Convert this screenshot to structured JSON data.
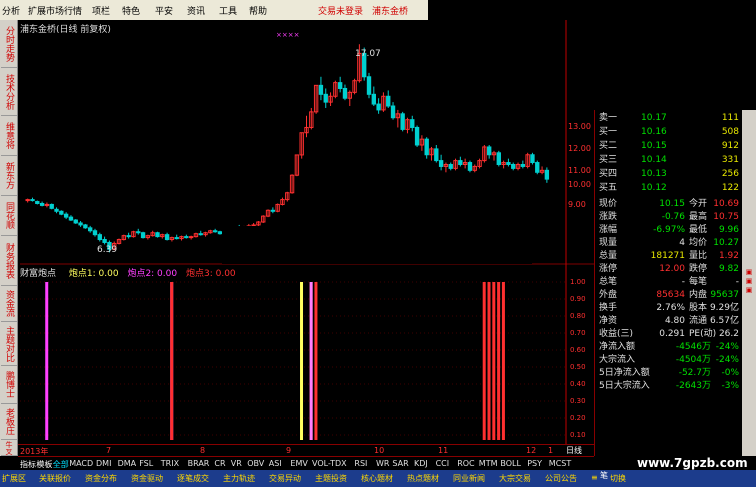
{
  "menu": {
    "items": [
      "分析",
      "扩展市场行情",
      "项栏",
      "特色",
      "平安",
      "资讯",
      "工具",
      "帮助"
    ],
    "login": "交易未登录",
    "stock": "浦东金桥"
  },
  "left_tabs": [
    "分时走势",
    "技术分析",
    "维意将",
    "新东方",
    "同花顺",
    "财务报表",
    "资金流",
    "主题对比",
    "鹏博士",
    "老板庄",
    "牛叉诊股"
  ],
  "main_chart": {
    "title": "浦东金桥(日线 前复权)",
    "high_label": "17.07",
    "low_label": "6.39",
    "y_ticks": [
      "13.00",
      "12.00",
      "11.00",
      "10.00",
      "9.00"
    ],
    "markers": "××××"
  },
  "indicator": {
    "name": "财富炮点",
    "p1_label": "炮点1: 0.00",
    "p2_label": "炮点2: 0.00",
    "p3_label": "炮点3: 0.00",
    "y_ticks": [
      "1.00",
      "0.90",
      "0.80",
      "0.70",
      "0.60",
      "0.50",
      "0.40",
      "0.30",
      "0.20",
      "0.10"
    ]
  },
  "x_axis": {
    "labels": [
      "2013年",
      "7",
      "8",
      "9",
      "10",
      "11",
      "12",
      "1"
    ]
  },
  "quote": {
    "rows": [
      {
        "l": "卖一",
        "v": "10.17",
        "r": "111"
      },
      {
        "l": "买一",
        "v": "10.16",
        "r": "508"
      },
      {
        "l": "买二",
        "v": "10.15",
        "r": "912"
      },
      {
        "l": "买三",
        "v": "10.14",
        "r": "331"
      },
      {
        "l": "买四",
        "v": "10.13",
        "r": "256"
      },
      {
        "l": "买五",
        "v": "10.12",
        "r": "122"
      }
    ],
    "stats": [
      {
        "a": "现价",
        "b": "10.15",
        "c": "今开",
        "d": "10.69"
      },
      {
        "a": "涨跌",
        "b": "-0.76",
        "c": "最高",
        "d": "10.75"
      },
      {
        "a": "涨幅",
        "b": "-6.97%",
        "c": "最低",
        "d": "9.96"
      },
      {
        "a": "现量",
        "b": "4",
        "c": "均价",
        "d": "10.27"
      },
      {
        "a": "总量",
        "b": "181271",
        "c": "量比",
        "d": "1.92"
      },
      {
        "a": "涨停",
        "b": "12.00",
        "c": "跌停",
        "d": "9.82"
      },
      {
        "a": "总笔",
        "b": "-",
        "c": "每笔",
        "d": "-"
      },
      {
        "a": "外盘",
        "b": "85634",
        "c": "内盘",
        "d": "95637"
      },
      {
        "a": "换手",
        "b": "2.76%",
        "c": "股本",
        "d": "9.29亿"
      },
      {
        "a": "净资",
        "b": "4.80",
        "c": "流通",
        "d": "6.57亿"
      },
      {
        "a": "收益(三)",
        "b": "0.291",
        "c": "PE(动)",
        "d": "26.2"
      }
    ],
    "flows": [
      {
        "a": "净流入额",
        "b": "-4546万",
        "c": "-24%"
      },
      {
        "a": "大宗流入",
        "b": "-4504万",
        "c": "-24%"
      },
      {
        "a": "5日净流入额",
        "b": "-52.7万",
        "c": "-0%"
      },
      {
        "a": "5日大宗流入",
        "b": "-2643万",
        "c": "-3%"
      }
    ]
  },
  "bottom_tabs": [
    "指标",
    "模板",
    "全部",
    "MACD",
    "DMI",
    "DMA",
    "FSL",
    "TRIX",
    "BRAR",
    "CR",
    "VR",
    "OBV",
    "ASI",
    "EMV",
    "VOL-TDX",
    "RSI",
    "WR",
    "SAR",
    "KDJ",
    "CCI",
    "ROC",
    "MTM",
    "BOLL",
    "PSY",
    "MCST"
  ],
  "status_tabs": [
    "扩展区",
    "关联报价",
    "资金分布",
    "资金驱动",
    "逐笔成交",
    "主力轨迹",
    "交易异动",
    "主题投资",
    "核心题材",
    "热点题材",
    "同业新闻",
    "大宗交易",
    "公司公告",
    "≡",
    "切换"
  ],
  "side_tabs": {
    "daily": "日线",
    "pen": "笔"
  },
  "watermark": "www.7gpzb.com",
  "chart_data": {
    "type": "candlestick",
    "ohlc": [
      [
        9.05,
        9.15,
        8.95,
        9.1
      ],
      [
        9.1,
        9.2,
        9.0,
        9.05
      ],
      [
        9.0,
        9.05,
        8.85,
        8.9
      ],
      [
        8.9,
        9.0,
        8.75,
        8.8
      ],
      [
        8.8,
        8.95,
        8.7,
        8.85
      ],
      [
        8.85,
        8.9,
        8.6,
        8.65
      ],
      [
        8.6,
        8.7,
        8.4,
        8.5
      ],
      [
        8.5,
        8.55,
        8.3,
        8.35
      ],
      [
        8.35,
        8.45,
        8.1,
        8.2
      ],
      [
        8.2,
        8.3,
        8.0,
        8.05
      ],
      [
        8.05,
        8.1,
        7.85,
        7.9
      ],
      [
        7.9,
        8.0,
        7.7,
        7.8
      ],
      [
        7.8,
        7.85,
        7.6,
        7.65
      ],
      [
        7.65,
        7.75,
        7.4,
        7.5
      ],
      [
        7.5,
        7.6,
        7.2,
        7.3
      ],
      [
        7.3,
        7.4,
        6.95,
        7.05
      ],
      [
        7.05,
        7.2,
        6.8,
        6.9
      ],
      [
        6.9,
        7.0,
        6.39,
        6.55
      ],
      [
        6.55,
        6.95,
        6.5,
        6.85
      ],
      [
        6.85,
        7.1,
        6.8,
        7.05
      ],
      [
        7.05,
        7.3,
        7.0,
        7.25
      ],
      [
        7.25,
        7.4,
        7.1,
        7.2
      ],
      [
        7.2,
        7.5,
        7.15,
        7.45
      ],
      [
        7.45,
        7.6,
        7.3,
        7.4
      ],
      [
        7.4,
        7.45,
        7.1,
        7.15
      ],
      [
        7.15,
        7.3,
        7.05,
        7.25
      ],
      [
        7.25,
        7.5,
        7.2,
        7.4
      ],
      [
        7.4,
        7.45,
        7.15,
        7.2
      ],
      [
        7.2,
        7.35,
        7.1,
        7.3
      ],
      [
        7.3,
        7.4,
        7.0,
        7.05
      ],
      [
        7.05,
        7.2,
        6.95,
        7.15
      ],
      [
        7.15,
        7.3,
        7.05,
        7.1
      ],
      [
        7.1,
        7.25,
        7.0,
        7.2
      ],
      [
        7.2,
        7.3,
        7.1,
        7.15
      ],
      [
        7.15,
        7.25,
        7.05,
        7.2
      ],
      [
        7.2,
        7.4,
        7.15,
        7.35
      ],
      [
        7.35,
        7.5,
        7.25,
        7.3
      ],
      [
        7.3,
        7.45,
        7.2,
        7.4
      ],
      [
        7.4,
        7.55,
        7.35,
        7.5
      ],
      [
        7.5,
        7.6,
        7.4,
        7.45
      ],
      [
        7.45,
        7.5,
        7.3,
        7.35
      ],
      [
        7.35,
        7.45,
        7.25,
        7.4
      ],
      [
        7.4,
        7.55,
        7.3,
        7.5
      ],
      [
        7.5,
        7.7,
        7.45,
        7.65
      ],
      [
        7.65,
        7.8,
        7.55,
        7.6
      ],
      [
        7.6,
        7.75,
        7.5,
        7.7
      ],
      [
        7.7,
        7.85,
        7.6,
        7.75
      ],
      [
        7.75,
        7.9,
        7.65,
        7.8
      ],
      [
        7.8,
        8.0,
        7.7,
        7.95
      ],
      [
        7.95,
        8.3,
        7.9,
        8.25
      ],
      [
        8.25,
        8.6,
        8.2,
        8.55
      ],
      [
        8.55,
        8.7,
        8.4,
        8.5
      ],
      [
        8.5,
        8.9,
        8.45,
        8.85
      ],
      [
        8.85,
        9.2,
        8.8,
        9.1
      ],
      [
        9.1,
        9.5,
        9.0,
        9.45
      ],
      [
        9.45,
        10.4,
        9.4,
        10.35
      ],
      [
        10.35,
        11.39,
        10.3,
        11.39
      ],
      [
        11.39,
        12.53,
        11.2,
        12.53
      ],
      [
        12.53,
        13.4,
        12.3,
        12.8
      ],
      [
        12.8,
        13.8,
        12.7,
        13.6
      ],
      [
        13.6,
        14.96,
        13.5,
        14.96
      ],
      [
        14.96,
        15.4,
        14.2,
        14.5
      ],
      [
        14.5,
        14.8,
        13.8,
        14.1
      ],
      [
        14.1,
        14.6,
        13.9,
        14.4
      ],
      [
        14.4,
        15.2,
        14.3,
        15.1
      ],
      [
        15.1,
        15.4,
        14.6,
        14.8
      ],
      [
        14.8,
        15.0,
        14.2,
        14.3
      ],
      [
        14.3,
        14.7,
        13.9,
        14.6
      ],
      [
        14.6,
        15.3,
        14.5,
        15.2
      ],
      [
        15.2,
        17.07,
        15.1,
        16.6
      ],
      [
        16.6,
        16.9,
        15.2,
        15.4
      ],
      [
        15.4,
        15.6,
        14.3,
        14.5
      ],
      [
        14.5,
        14.9,
        13.9,
        14.0
      ],
      [
        14.0,
        14.3,
        13.5,
        13.7
      ],
      [
        13.7,
        14.6,
        13.6,
        14.4
      ],
      [
        14.4,
        14.7,
        13.8,
        13.9
      ],
      [
        13.9,
        14.1,
        13.2,
        13.3
      ],
      [
        13.3,
        13.7,
        12.8,
        13.5
      ],
      [
        13.5,
        13.6,
        12.6,
        12.7
      ],
      [
        12.7,
        13.3,
        12.5,
        13.2
      ],
      [
        13.2,
        13.4,
        12.6,
        12.8
      ],
      [
        12.8,
        12.9,
        11.8,
        11.9
      ],
      [
        11.9,
        12.4,
        11.6,
        12.2
      ],
      [
        12.2,
        12.3,
        11.2,
        11.4
      ],
      [
        11.4,
        11.8,
        11.1,
        11.7
      ],
      [
        11.7,
        11.9,
        11.0,
        11.1
      ],
      [
        11.1,
        11.4,
        10.6,
        10.8
      ],
      [
        10.8,
        11.0,
        10.5,
        10.9
      ],
      [
        10.9,
        11.0,
        10.6,
        10.7
      ],
      [
        10.7,
        11.2,
        10.6,
        11.1
      ],
      [
        11.1,
        11.3,
        10.8,
        10.9
      ],
      [
        10.9,
        11.2,
        10.7,
        11.0
      ],
      [
        11.0,
        11.1,
        10.5,
        10.6
      ],
      [
        10.6,
        10.9,
        10.5,
        10.8
      ],
      [
        10.8,
        11.2,
        10.7,
        11.1
      ],
      [
        11.1,
        11.9,
        11.0,
        11.8
      ],
      [
        11.8,
        11.9,
        11.2,
        11.4
      ],
      [
        11.4,
        11.6,
        11.1,
        11.5
      ],
      [
        11.5,
        11.6,
        10.8,
        10.9
      ],
      [
        10.9,
        11.1,
        10.7,
        11.0
      ],
      [
        11.0,
        11.2,
        10.8,
        10.9
      ],
      [
        10.9,
        11.0,
        10.6,
        10.7
      ],
      [
        10.7,
        11.0,
        10.6,
        10.9
      ],
      [
        10.9,
        11.1,
        10.7,
        10.8
      ],
      [
        10.8,
        11.5,
        10.7,
        11.4
      ],
      [
        11.4,
        11.5,
        10.9,
        11.0
      ],
      [
        11.0,
        11.1,
        10.4,
        10.5
      ],
      [
        10.5,
        10.8,
        10.4,
        10.6
      ],
      [
        10.6,
        10.75,
        9.96,
        10.15
      ]
    ],
    "signals": [
      {
        "series": "炮点1",
        "color": "#ff40ff",
        "positions": [
          4
        ]
      },
      {
        "series": "炮点2",
        "color": "#ff40ff",
        "positions": [
          30
        ]
      },
      {
        "series": "炮点3",
        "color": "#ff3030",
        "positions": [
          30,
          59,
          60,
          95,
          96,
          97,
          98,
          99
        ]
      },
      {
        "series": "yellow",
        "color": "#ffff60",
        "positions": [
          57
        ]
      },
      {
        "series": "pink",
        "color": "#ff80ff",
        "positions": [
          59
        ]
      }
    ],
    "ylim": [
      6.0,
      17.8
    ]
  },
  "colors": {
    "up": "#ff3030",
    "down": "#00d0d0",
    "bg": "#000000",
    "grid": "#800000",
    "axis": "#c00000"
  }
}
